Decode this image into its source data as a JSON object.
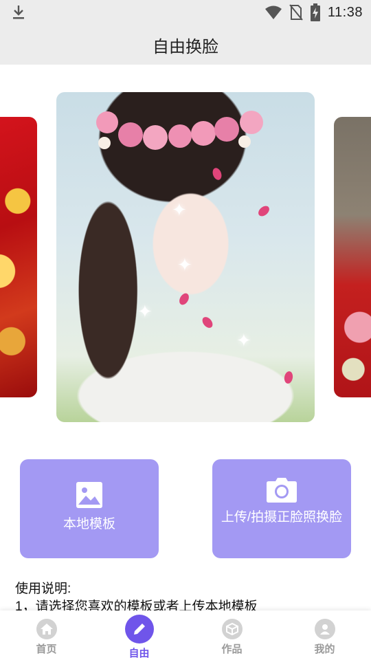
{
  "status_bar": {
    "time": "11:38",
    "icons": [
      "download-icon",
      "wifi-icon",
      "no-sim-icon",
      "battery-charging-icon"
    ]
  },
  "header": {
    "title": "自由换脸"
  },
  "carousel": {
    "cards": [
      "left-template-card",
      "center-template-card",
      "right-template-card"
    ]
  },
  "actions": {
    "local_template": {
      "label": "本地模板",
      "icon": "image-icon"
    },
    "upload_photo": {
      "label": "上传/拍摄正脸照换脸",
      "icon": "camera-icon"
    }
  },
  "instructions": {
    "heading": "使用说明:",
    "step1": "1，请选择您喜欢的模板或者上传本地模板"
  },
  "bottom_nav": {
    "items": [
      {
        "label": "首页",
        "icon": "home-icon",
        "active": false
      },
      {
        "label": "自由",
        "icon": "pencil-icon",
        "active": true
      },
      {
        "label": "作品",
        "icon": "cube-icon",
        "active": false
      },
      {
        "label": "我的",
        "icon": "user-icon",
        "active": false
      }
    ]
  },
  "colors": {
    "accent": "#6f55ea",
    "button_bg": "#a399f3",
    "header_bg": "#ececec",
    "inactive_nav": "#9a9a9a"
  }
}
